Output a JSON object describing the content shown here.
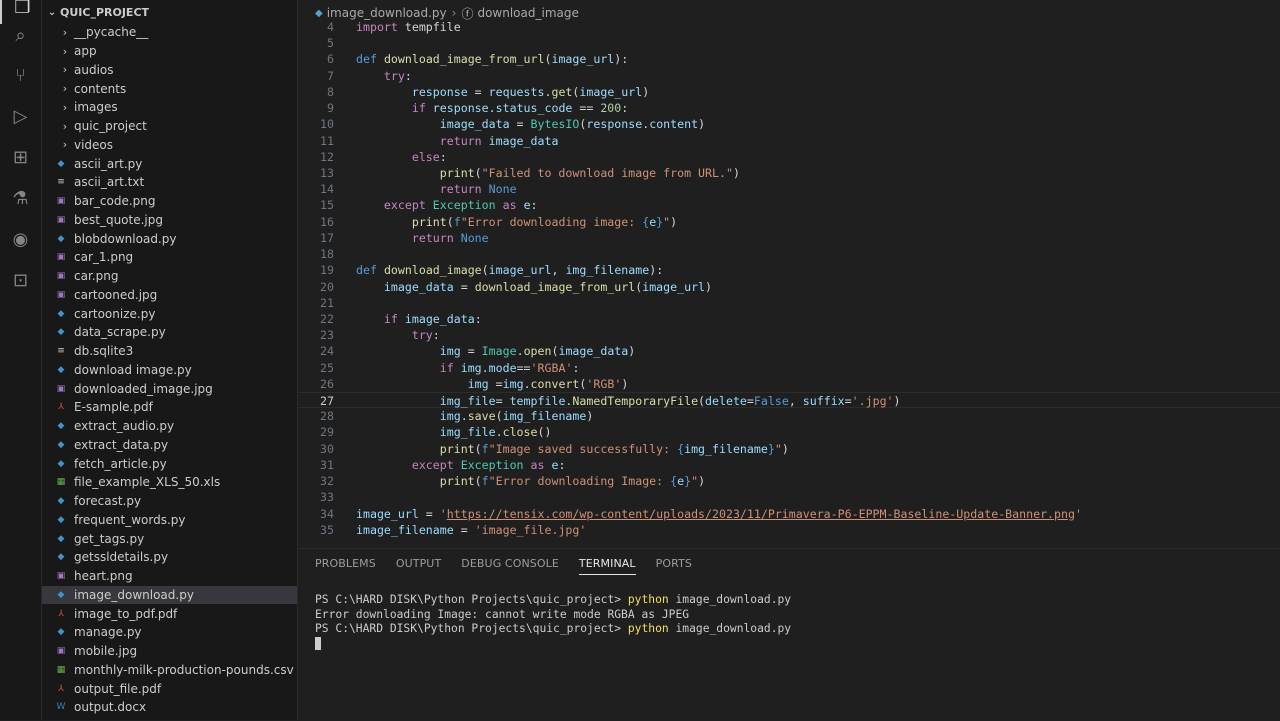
{
  "activity_bar": {
    "icons": [
      "files-icon",
      "search-icon",
      "source-control-icon",
      "run-debug-icon",
      "extensions-icon",
      "testing-icon",
      "remote-icon",
      "terminal-icon"
    ]
  },
  "explorer": {
    "project_name": "QUIC_PROJECT",
    "items": [
      {
        "name": "__pycache__",
        "type": "folder"
      },
      {
        "name": "app",
        "type": "folder"
      },
      {
        "name": "audios",
        "type": "folder"
      },
      {
        "name": "contents",
        "type": "folder"
      },
      {
        "name": "images",
        "type": "folder"
      },
      {
        "name": "quic_project",
        "type": "folder"
      },
      {
        "name": "videos",
        "type": "folder"
      },
      {
        "name": "ascii_art.py",
        "type": "py"
      },
      {
        "name": "ascii_art.txt",
        "type": "txt"
      },
      {
        "name": "bar_code.png",
        "type": "img"
      },
      {
        "name": "best_quote.jpg",
        "type": "img"
      },
      {
        "name": "blobdownload.py",
        "type": "py"
      },
      {
        "name": "car_1.png",
        "type": "img"
      },
      {
        "name": "car.png",
        "type": "img"
      },
      {
        "name": "cartooned.jpg",
        "type": "img"
      },
      {
        "name": "cartoonize.py",
        "type": "py"
      },
      {
        "name": "data_scrape.py",
        "type": "py"
      },
      {
        "name": "db.sqlite3",
        "type": "db"
      },
      {
        "name": "download image.py",
        "type": "py"
      },
      {
        "name": "downloaded_image.jpg",
        "type": "img"
      },
      {
        "name": "E-sample.pdf",
        "type": "pdf"
      },
      {
        "name": "extract_audio.py",
        "type": "py"
      },
      {
        "name": "extract_data.py",
        "type": "py"
      },
      {
        "name": "fetch_article.py",
        "type": "py"
      },
      {
        "name": "file_example_XLS_50.xls",
        "type": "xls"
      },
      {
        "name": "forecast.py",
        "type": "py"
      },
      {
        "name": "frequent_words.py",
        "type": "py"
      },
      {
        "name": "get_tags.py",
        "type": "py"
      },
      {
        "name": "getssldetails.py",
        "type": "py"
      },
      {
        "name": "heart.png",
        "type": "img"
      },
      {
        "name": "image_download.py",
        "type": "py",
        "selected": true
      },
      {
        "name": "image_to_pdf.pdf",
        "type": "pdf"
      },
      {
        "name": "manage.py",
        "type": "py"
      },
      {
        "name": "mobile.jpg",
        "type": "img"
      },
      {
        "name": "monthly-milk-production-pounds.csv",
        "type": "csv"
      },
      {
        "name": "output_file.pdf",
        "type": "pdf"
      },
      {
        "name": "output.docx",
        "type": "docx"
      }
    ]
  },
  "editor": {
    "breadcrumb": {
      "file": "image_download.py",
      "symbol": "download_image"
    },
    "current_line": 27,
    "lines": [
      {
        "n": "4",
        "t": [
          [
            "kw",
            "import"
          ],
          [
            "pl",
            " tempfile"
          ]
        ]
      },
      {
        "n": "5",
        "t": []
      },
      {
        "n": "6",
        "t": [
          [
            "kd",
            "def"
          ],
          [
            "pl",
            " "
          ],
          [
            "fn",
            "download_image_from_url"
          ],
          [
            "pl",
            "("
          ],
          [
            "var",
            "image_url"
          ],
          [
            "pl",
            "):"
          ]
        ]
      },
      {
        "n": "7",
        "t": [
          [
            "pl",
            "    "
          ],
          [
            "kw",
            "try"
          ],
          [
            "pl",
            ":"
          ]
        ]
      },
      {
        "n": "8",
        "t": [
          [
            "pl",
            "        "
          ],
          [
            "var",
            "response"
          ],
          [
            "pl",
            " = "
          ],
          [
            "var",
            "requests"
          ],
          [
            "pl",
            "."
          ],
          [
            "fn",
            "get"
          ],
          [
            "pl",
            "("
          ],
          [
            "var",
            "image_url"
          ],
          [
            "pl",
            ")"
          ]
        ]
      },
      {
        "n": "9",
        "t": [
          [
            "pl",
            "        "
          ],
          [
            "kw",
            "if"
          ],
          [
            "pl",
            " "
          ],
          [
            "var",
            "response"
          ],
          [
            "pl",
            "."
          ],
          [
            "var",
            "status_code"
          ],
          [
            "pl",
            " == "
          ],
          [
            "num",
            "200"
          ],
          [
            "pl",
            ":"
          ]
        ]
      },
      {
        "n": "10",
        "t": [
          [
            "pl",
            "            "
          ],
          [
            "var",
            "image_data"
          ],
          [
            "pl",
            " = "
          ],
          [
            "cls",
            "BytesIO"
          ],
          [
            "pl",
            "("
          ],
          [
            "var",
            "response"
          ],
          [
            "pl",
            "."
          ],
          [
            "var",
            "content"
          ],
          [
            "pl",
            ")"
          ]
        ]
      },
      {
        "n": "11",
        "t": [
          [
            "pl",
            "            "
          ],
          [
            "kw",
            "return"
          ],
          [
            "pl",
            " "
          ],
          [
            "var",
            "image_data"
          ]
        ]
      },
      {
        "n": "12",
        "t": [
          [
            "pl",
            "        "
          ],
          [
            "kw",
            "else"
          ],
          [
            "pl",
            ":"
          ]
        ]
      },
      {
        "n": "13",
        "t": [
          [
            "pl",
            "            "
          ],
          [
            "fn",
            "print"
          ],
          [
            "pl",
            "("
          ],
          [
            "str",
            "\"Failed to download image from URL.\""
          ],
          [
            "pl",
            ")"
          ]
        ]
      },
      {
        "n": "14",
        "t": [
          [
            "pl",
            "            "
          ],
          [
            "kw",
            "return"
          ],
          [
            "pl",
            " "
          ],
          [
            "kd",
            "None"
          ]
        ]
      },
      {
        "n": "15",
        "t": [
          [
            "pl",
            "    "
          ],
          [
            "kw",
            "except"
          ],
          [
            "pl",
            " "
          ],
          [
            "cls",
            "Exception"
          ],
          [
            "pl",
            " "
          ],
          [
            "kw",
            "as"
          ],
          [
            "pl",
            " "
          ],
          [
            "var",
            "e"
          ],
          [
            "pl",
            ":"
          ]
        ]
      },
      {
        "n": "16",
        "t": [
          [
            "pl",
            "        "
          ],
          [
            "fn",
            "print"
          ],
          [
            "pl",
            "("
          ],
          [
            "kd",
            "f"
          ],
          [
            "str",
            "\"Error downloading image: "
          ],
          [
            "kd",
            "{"
          ],
          [
            "var",
            "e"
          ],
          [
            "kd",
            "}"
          ],
          [
            "str",
            "\""
          ],
          [
            "pl",
            ")"
          ]
        ]
      },
      {
        "n": "17",
        "t": [
          [
            "pl",
            "        "
          ],
          [
            "kw",
            "return"
          ],
          [
            "pl",
            " "
          ],
          [
            "kd",
            "None"
          ]
        ]
      },
      {
        "n": "18",
        "t": []
      },
      {
        "n": "19",
        "t": [
          [
            "kd",
            "def"
          ],
          [
            "pl",
            " "
          ],
          [
            "fn",
            "download_image"
          ],
          [
            "pl",
            "("
          ],
          [
            "var",
            "image_url"
          ],
          [
            "pl",
            ", "
          ],
          [
            "var",
            "img_filename"
          ],
          [
            "pl",
            "):"
          ]
        ]
      },
      {
        "n": "20",
        "t": [
          [
            "pl",
            "    "
          ],
          [
            "var",
            "image_data"
          ],
          [
            "pl",
            " = "
          ],
          [
            "fn",
            "download_image_from_url"
          ],
          [
            "pl",
            "("
          ],
          [
            "var",
            "image_url"
          ],
          [
            "pl",
            ")"
          ]
        ]
      },
      {
        "n": "21",
        "t": []
      },
      {
        "n": "22",
        "t": [
          [
            "pl",
            "    "
          ],
          [
            "kw",
            "if"
          ],
          [
            "pl",
            " "
          ],
          [
            "var",
            "image_data"
          ],
          [
            "pl",
            ":"
          ]
        ]
      },
      {
        "n": "23",
        "t": [
          [
            "pl",
            "        "
          ],
          [
            "kw",
            "try"
          ],
          [
            "pl",
            ":"
          ]
        ]
      },
      {
        "n": "24",
        "t": [
          [
            "pl",
            "            "
          ],
          [
            "var",
            "img"
          ],
          [
            "pl",
            " = "
          ],
          [
            "cls",
            "Image"
          ],
          [
            "pl",
            "."
          ],
          [
            "fn",
            "open"
          ],
          [
            "pl",
            "("
          ],
          [
            "var",
            "image_data"
          ],
          [
            "pl",
            ")"
          ]
        ]
      },
      {
        "n": "25",
        "t": [
          [
            "pl",
            "            "
          ],
          [
            "kw",
            "if"
          ],
          [
            "pl",
            " "
          ],
          [
            "var",
            "img"
          ],
          [
            "pl",
            "."
          ],
          [
            "var",
            "mode"
          ],
          [
            "pl",
            "=="
          ],
          [
            "str",
            "'RGBA'"
          ],
          [
            "pl",
            ":"
          ]
        ]
      },
      {
        "n": "26",
        "t": [
          [
            "pl",
            "                "
          ],
          [
            "var",
            "img"
          ],
          [
            "pl",
            " ="
          ],
          [
            "var",
            "img"
          ],
          [
            "pl",
            "."
          ],
          [
            "fn",
            "convert"
          ],
          [
            "pl",
            "("
          ],
          [
            "str",
            "'RGB'"
          ],
          [
            "pl",
            ")"
          ]
        ]
      },
      {
        "n": "27",
        "t": [
          [
            "pl",
            "            "
          ],
          [
            "var",
            "img_file"
          ],
          [
            "pl",
            "= "
          ],
          [
            "var",
            "tempfile"
          ],
          [
            "pl",
            "."
          ],
          [
            "fn",
            "NamedTemporaryFile"
          ],
          [
            "pl",
            "("
          ],
          [
            "var",
            "delete"
          ],
          [
            "pl",
            "="
          ],
          [
            "kd",
            "False"
          ],
          [
            "pl",
            ", "
          ],
          [
            "var",
            "suffix"
          ],
          [
            "pl",
            "="
          ],
          [
            "str",
            "'.jpg'"
          ],
          [
            "pl",
            ")"
          ]
        ]
      },
      {
        "n": "28",
        "t": [
          [
            "pl",
            "            "
          ],
          [
            "var",
            "img"
          ],
          [
            "pl",
            "."
          ],
          [
            "fn",
            "save"
          ],
          [
            "pl",
            "("
          ],
          [
            "var",
            "img_filename"
          ],
          [
            "pl",
            ")"
          ]
        ]
      },
      {
        "n": "29",
        "t": [
          [
            "pl",
            "            "
          ],
          [
            "var",
            "img_file"
          ],
          [
            "pl",
            "."
          ],
          [
            "fn",
            "close"
          ],
          [
            "pl",
            "()"
          ]
        ]
      },
      {
        "n": "30",
        "t": [
          [
            "pl",
            "            "
          ],
          [
            "fn",
            "print"
          ],
          [
            "pl",
            "("
          ],
          [
            "kd",
            "f"
          ],
          [
            "str",
            "\"Image saved successfully: "
          ],
          [
            "kd",
            "{"
          ],
          [
            "var",
            "img_filename"
          ],
          [
            "kd",
            "}"
          ],
          [
            "str",
            "\""
          ],
          [
            "pl",
            ")"
          ]
        ]
      },
      {
        "n": "31",
        "t": [
          [
            "pl",
            "        "
          ],
          [
            "kw",
            "except"
          ],
          [
            "pl",
            " "
          ],
          [
            "cls",
            "Exception"
          ],
          [
            "pl",
            " "
          ],
          [
            "kw",
            "as"
          ],
          [
            "pl",
            " "
          ],
          [
            "var",
            "e"
          ],
          [
            "pl",
            ":"
          ]
        ]
      },
      {
        "n": "32",
        "t": [
          [
            "pl",
            "            "
          ],
          [
            "fn",
            "print"
          ],
          [
            "pl",
            "("
          ],
          [
            "kd",
            "f"
          ],
          [
            "str",
            "\"Error downloading Image: "
          ],
          [
            "kd",
            "{"
          ],
          [
            "var",
            "e"
          ],
          [
            "kd",
            "}"
          ],
          [
            "str",
            "\""
          ],
          [
            "pl",
            ")"
          ]
        ]
      },
      {
        "n": "33",
        "t": []
      },
      {
        "n": "34",
        "t": [
          [
            "var",
            "image_url"
          ],
          [
            "pl",
            " = "
          ],
          [
            "str",
            "'"
          ],
          [
            "url",
            "https://tensix.com/wp-content/uploads/2023/11/Primavera-P6-EPPM-Baseline-Update-Banner.png"
          ],
          [
            "str",
            "'"
          ]
        ]
      },
      {
        "n": "35",
        "t": [
          [
            "var",
            "image_filename"
          ],
          [
            "pl",
            " = "
          ],
          [
            "str",
            "'image_file.jpg'"
          ]
        ]
      }
    ]
  },
  "panel": {
    "tabs": [
      {
        "label": "PROBLEMS",
        "active": false
      },
      {
        "label": "OUTPUT",
        "active": false
      },
      {
        "label": "DEBUG CONSOLE",
        "active": false
      },
      {
        "label": "TERMINAL",
        "active": true
      },
      {
        "label": "PORTS",
        "active": false
      }
    ],
    "terminal_lines": [
      {
        "prompt": "PS C:\\HARD DISK\\Python Projects\\quic_project> ",
        "cmd": "python",
        "args": " image_download.py"
      },
      {
        "text": "Error downloading Image: cannot write mode RGBA as JPEG"
      },
      {
        "prompt": "PS C:\\HARD DISK\\Python Projects\\quic_project> ",
        "cmd": "python",
        "args": " image_download.py"
      }
    ]
  },
  "colors": {
    "py": "#3e95cf",
    "img": "#a074c4",
    "pdf": "#e44d4d",
    "xls": "#6bb04c",
    "csv": "#6bb04c",
    "db": "#cccccc",
    "txt": "#cccccc",
    "docx": "#3c7fc6"
  }
}
